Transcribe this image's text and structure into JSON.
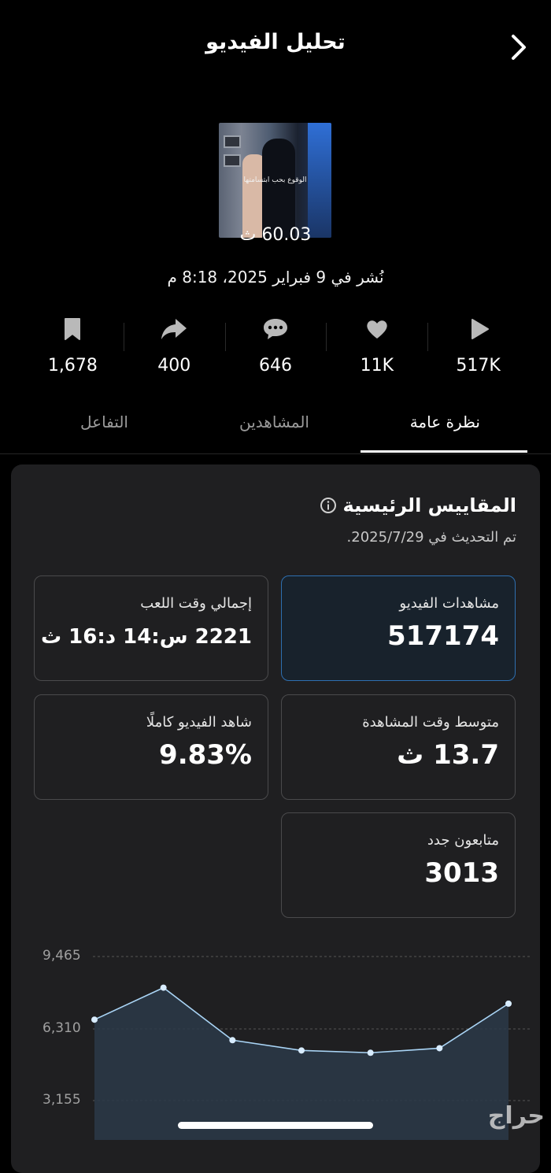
{
  "header": {
    "title": "تحليل الفيديو"
  },
  "video": {
    "caption": "الوقوع بحب ابتسامتها",
    "duration": "60.03 ث",
    "published": "نُشر في 9 فبراير 2025، 8:18 م"
  },
  "stats": [
    {
      "icon": "play-icon",
      "value": "517K"
    },
    {
      "icon": "heart-icon",
      "value": "11K"
    },
    {
      "icon": "comment-icon",
      "value": "646"
    },
    {
      "icon": "share-icon",
      "value": "400"
    },
    {
      "icon": "bookmark-icon",
      "value": "1,678"
    }
  ],
  "tabs": [
    {
      "label": "نظرة عامة",
      "active": true
    },
    {
      "label": "المشاهدين",
      "active": false
    },
    {
      "label": "التفاعل",
      "active": false
    }
  ],
  "key_metrics": {
    "title": "المقاييس الرئيسية",
    "updated": "تم التحديث في 2025/7/29.",
    "items": [
      {
        "label": "مشاهدات الفيديو",
        "value": "517174",
        "selected": true
      },
      {
        "label": "إجمالي وقت اللعب",
        "value": "2221 س:14 د:16 ث",
        "selected": false
      },
      {
        "label": "متوسط وقت المشاهدة",
        "value": "13.7 ث",
        "selected": false
      },
      {
        "label": "شاهد الفيديو كاملًا",
        "value": "9.83%",
        "selected": false
      },
      {
        "label": "متابعون جدد",
        "value": "3013",
        "selected": false
      }
    ]
  },
  "chart_data": {
    "type": "area",
    "x": [
      1,
      2,
      3,
      4,
      5,
      6,
      7
    ],
    "values": [
      6700,
      8100,
      5800,
      5350,
      5250,
      5450,
      7400
    ],
    "yticks": [
      "9,465",
      "6,310",
      "3,155"
    ],
    "ytick_values": [
      9465,
      6310,
      3155
    ],
    "grid": true,
    "colors": {
      "line": "#a9d4f5",
      "point": "#d8ecff",
      "fill": "#2b3a48"
    }
  },
  "watermark": "حراج"
}
